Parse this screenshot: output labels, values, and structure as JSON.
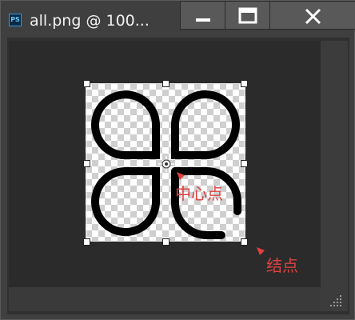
{
  "window": {
    "app_icon": "PS",
    "title": "all.png @ 100...",
    "buttons": {
      "minimize": "minimize-icon",
      "maximize": "maximize-icon",
      "close": "close-icon"
    }
  },
  "annotations": {
    "center_label": "中心点",
    "node_label": "结点",
    "label_color": "#e04040"
  },
  "colors": {
    "background": "#2b2b2b",
    "titlebar": "#3f3f3f",
    "button": "#595959"
  }
}
